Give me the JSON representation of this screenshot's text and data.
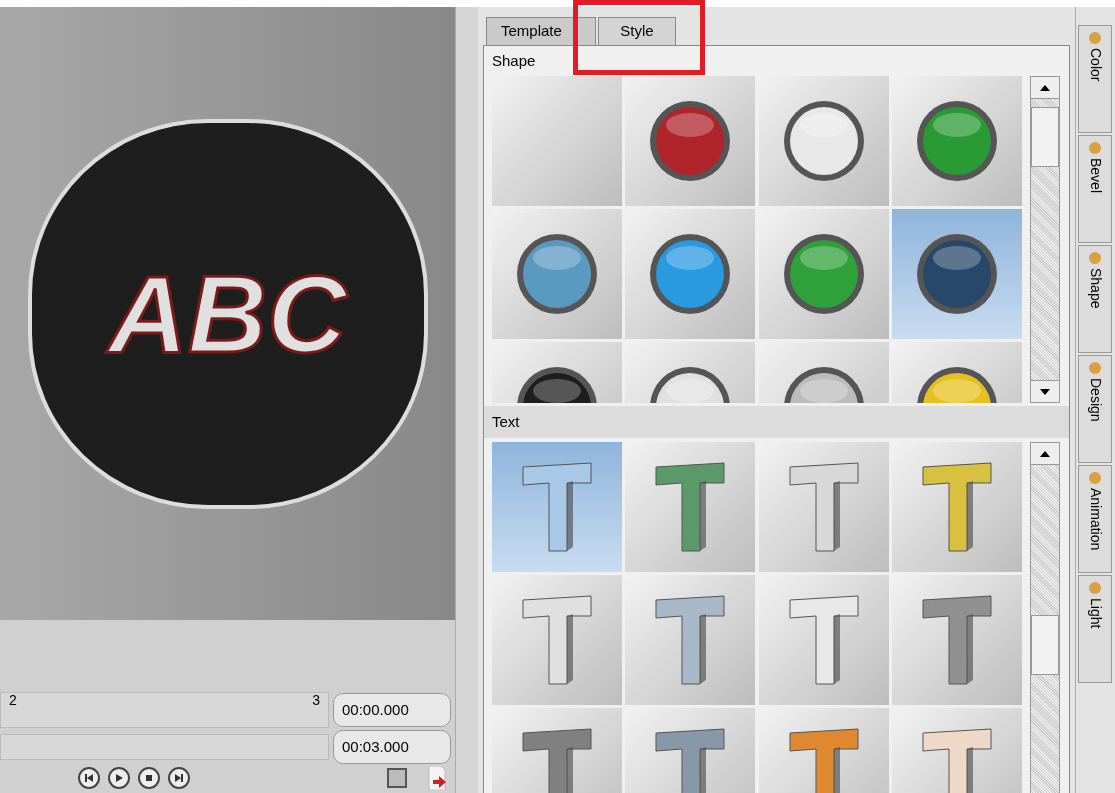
{
  "preview": {
    "text": "ABC"
  },
  "timeline": {
    "ticks": [
      "2",
      "3"
    ],
    "current_time": "00:00.000",
    "end_time": "00:03.000"
  },
  "tabs": [
    {
      "label": "Template",
      "selected": false
    },
    {
      "label": "Style",
      "selected": true
    }
  ],
  "shape_section": {
    "title": "Shape",
    "items": [
      {
        "kind": "blank",
        "selected": false
      },
      {
        "kind": "ball",
        "color": "#b0242c",
        "selected": false
      },
      {
        "kind": "ball",
        "color": "#e8e8e8",
        "selected": false
      },
      {
        "kind": "ball",
        "color": "#2a9a35",
        "selected": false
      },
      {
        "kind": "ball",
        "color": "#5a9ac0",
        "selected": false
      },
      {
        "kind": "ball",
        "color": "#2a9ae0",
        "selected": false
      },
      {
        "kind": "ball",
        "color": "#30a03a",
        "selected": false
      },
      {
        "kind": "ball",
        "color": "#27486a",
        "selected": true
      },
      {
        "kind": "ball",
        "color": "#1e1e1e",
        "selected": false
      },
      {
        "kind": "ball",
        "color": "#e0e0e0",
        "selected": false
      },
      {
        "kind": "ball",
        "color": "#bcbcbc",
        "selected": false
      },
      {
        "kind": "ball",
        "color": "#e6c020",
        "selected": false
      }
    ]
  },
  "text_section": {
    "title": "Text",
    "items": [
      {
        "color": "#a8c8e8",
        "selected": true
      },
      {
        "color": "#5a9a6a",
        "selected": false
      },
      {
        "color": "#d8d8d8",
        "selected": false
      },
      {
        "color": "#d8c040",
        "selected": false
      },
      {
        "color": "#e0e0e0",
        "selected": false
      },
      {
        "color": "#a8b8c8",
        "selected": false
      },
      {
        "color": "#e8e8e8",
        "selected": false
      },
      {
        "color": "#909090",
        "selected": false
      },
      {
        "color": "#808080",
        "selected": false
      },
      {
        "color": "#8898a8",
        "selected": false
      },
      {
        "color": "#e08830",
        "selected": false
      },
      {
        "color": "#f0d8c8",
        "selected": false
      }
    ]
  },
  "side_tabs": [
    {
      "label": "Color",
      "selected": false
    },
    {
      "label": "Bevel",
      "selected": false
    },
    {
      "label": "Shape",
      "selected": false
    },
    {
      "label": "Design",
      "selected": false
    },
    {
      "label": "Animation",
      "selected": false
    },
    {
      "label": "Light",
      "selected": false
    }
  ]
}
